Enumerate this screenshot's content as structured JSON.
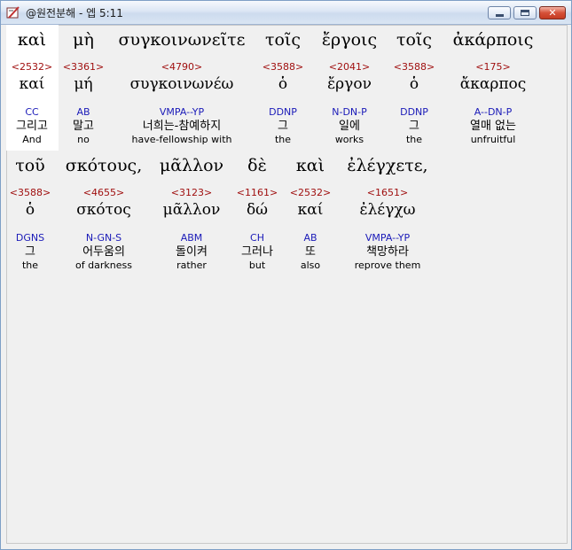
{
  "window": {
    "title": "@원전분해 - 엡 5:11",
    "minimize": "minimize",
    "maximize": "maximize",
    "close_label": "✕",
    "icons": {
      "app": "pencil-book-icon"
    }
  },
  "rows": [
    {
      "words": [
        {
          "greek": "καὶ",
          "strong": "<2532>",
          "lemma": "καί",
          "morph": "CC",
          "korean": "그리고",
          "english": "And"
        },
        {
          "greek": "μὴ",
          "strong": "<3361>",
          "lemma": "μή",
          "morph": "AB",
          "korean": "말고",
          "english": "no"
        },
        {
          "greek": "συγκοινωνεῖτε",
          "strong": "<4790>",
          "lemma": "συγκοινωνέω",
          "morph": "VMPA--YP",
          "korean": "너희는-참예하지",
          "english": "have-fellowship with"
        },
        {
          "greek": "τοῖς",
          "strong": "<3588>",
          "lemma": "ὁ",
          "morph": "DDNP",
          "korean": "그",
          "english": "the"
        },
        {
          "greek": "ἔργοις",
          "strong": "<2041>",
          "lemma": "ἔργον",
          "morph": "N-DN-P",
          "korean": "일에",
          "english": "works"
        },
        {
          "greek": "τοῖς",
          "strong": "<3588>",
          "lemma": "ὁ",
          "morph": "DDNP",
          "korean": "그",
          "english": "the"
        },
        {
          "greek": "ἀκάρποις",
          "strong": "<175>",
          "lemma": "ἄκαρπος",
          "morph": "A--DN-P",
          "korean": "열매 없는",
          "english": "unfruitful"
        }
      ]
    },
    {
      "words": [
        {
          "greek": "τοῦ",
          "strong": "<3588>",
          "lemma": "ὁ",
          "morph": "DGNS",
          "korean": "그",
          "english": "the"
        },
        {
          "greek": "σκότους,",
          "strong": "<4655>",
          "lemma": "σκότος",
          "morph": "N-GN-S",
          "korean": "어두움의",
          "english": "of darkness"
        },
        {
          "greek": "μᾶλλον",
          "strong": "<3123>",
          "lemma": "μᾶλλον",
          "morph": "ABM",
          "korean": "돌이켜",
          "english": "rather"
        },
        {
          "greek": "δὲ",
          "strong": "<1161>",
          "lemma": "δώ",
          "morph": "CH",
          "korean": "그러나",
          "english": "but"
        },
        {
          "greek": "καὶ",
          "strong": "<2532>",
          "lemma": "καί",
          "morph": "AB",
          "korean": "또",
          "english": "also"
        },
        {
          "greek": "ἐλέγχετε,",
          "strong": "<1651>",
          "lemma": "ἐλέγχω",
          "morph": "VMPA--YP",
          "korean": "책망하라",
          "english": "reprove them"
        }
      ]
    }
  ]
}
